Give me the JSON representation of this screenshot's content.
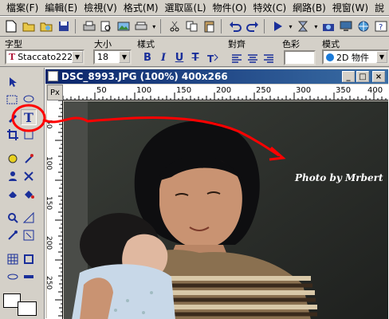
{
  "menu": [
    "檔案(F)",
    "編輯(E)",
    "檢視(V)",
    "格式(M)",
    "選取區(L)",
    "物件(O)",
    "特效(C)",
    "網路(B)",
    "視窗(W)",
    "說"
  ],
  "toolbar": {
    "icons": [
      "new-icon",
      "open-icon",
      "browse-icon",
      "save-icon",
      "print-icon",
      "print-preview-icon",
      "image-icon",
      "scan-icon",
      "cut-icon",
      "copy-icon",
      "paste-icon",
      "undo-icon",
      "redo-icon",
      "select-icon",
      "hourglass-icon",
      "camera-icon",
      "desktop-icon",
      "web-icon",
      "help-icon"
    ]
  },
  "properties": {
    "labels": {
      "font": "字型",
      "size": "大小",
      "style": "樣式",
      "align": "對齊",
      "color": "色彩",
      "mode": "模式"
    },
    "font_value": "Staccato222 I",
    "font_glyph": "T",
    "size_value": "18",
    "style_buttons": [
      "B",
      "I",
      "U",
      "T"
    ],
    "align_buttons": [
      "≡",
      "≡",
      "≡"
    ],
    "mode_value": "2D 物件"
  },
  "document": {
    "title": "DSC_8993.JPG (100%) 400x266",
    "ruler_unit": "Px",
    "ruler_top_ticks": [
      "50",
      "100",
      "150",
      "200",
      "250",
      "300",
      "350",
      "400"
    ],
    "ruler_left_ticks": [
      "50",
      "100",
      "150",
      "200",
      "250"
    ],
    "watermark": "Photo by Mrbert"
  },
  "colors": {
    "titlebar_start": "#0a246a",
    "titlebar_end": "#3a6ea5",
    "annotation": "#ff0000",
    "ui_face": "#d4d0c8",
    "tool_icon": "#1a2f9a"
  },
  "toolbox": {
    "tools": [
      "pointer-tool",
      "select-tool",
      "lasso-tool",
      "text-tool",
      "crop-tool",
      "transform-tool",
      "paint-tool",
      "clone-tool",
      "magic-wand-tool",
      "retouch-tool",
      "eraser-tool",
      "fill-tool",
      "zoom-tool",
      "measure-tool",
      "eyedropper-tool",
      "smart-tool",
      "grid-tool",
      "frame-tool",
      "path-tool",
      "shape-tool"
    ]
  }
}
